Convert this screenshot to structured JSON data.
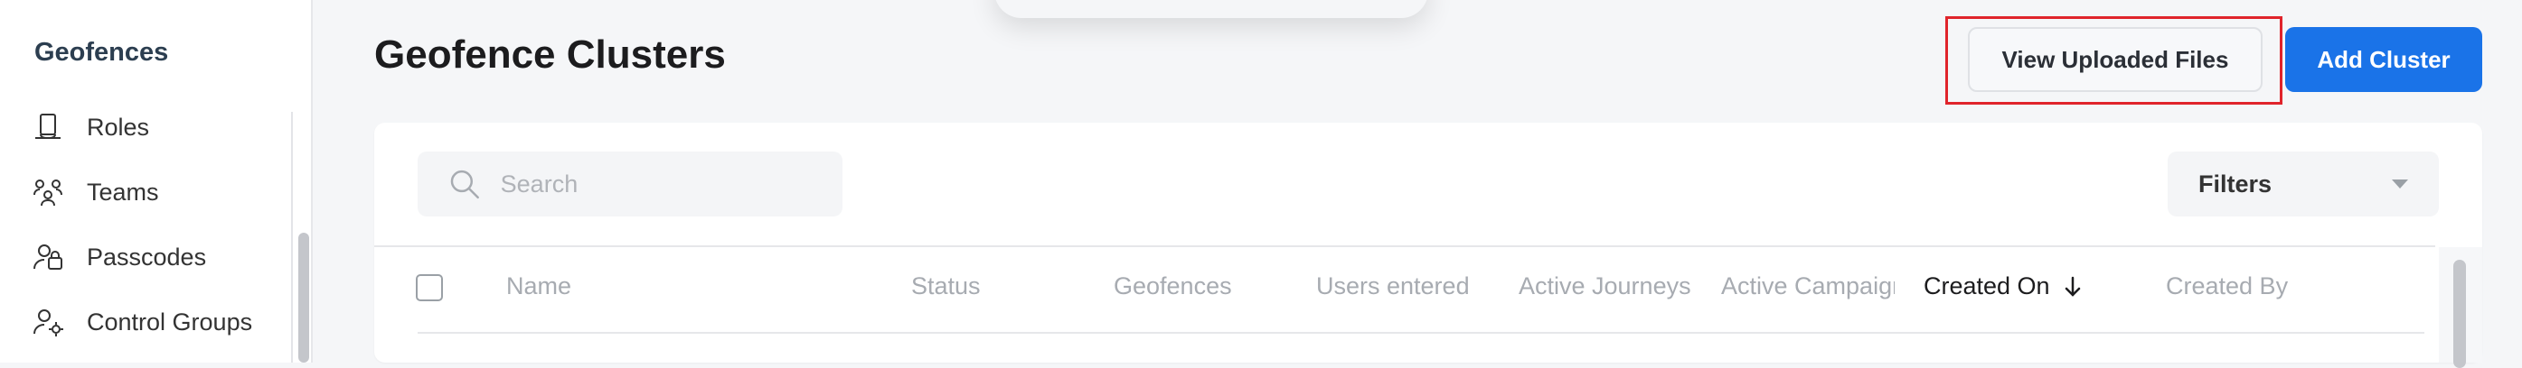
{
  "sidebar": {
    "section_title": "Geofences",
    "items": [
      {
        "label": "Roles",
        "icon": "hat-icon"
      },
      {
        "label": "Teams",
        "icon": "teams-icon"
      },
      {
        "label": "Passcodes",
        "icon": "passcodes-icon"
      },
      {
        "label": "Control Groups",
        "icon": "user-gear-icon"
      }
    ]
  },
  "header": {
    "title": "Geofence Clusters",
    "view_uploaded_label": "View Uploaded Files",
    "add_cluster_label": "Add Cluster"
  },
  "toolbar": {
    "search_placeholder": "Search",
    "filters_label": "Filters"
  },
  "table": {
    "columns": [
      "Name",
      "Status",
      "Geofences",
      "Users entered",
      "Active Journeys",
      "Active Campaigns",
      "Created On",
      "Created By"
    ],
    "sorted_column": "Created On",
    "sort_direction": "descending"
  },
  "colors": {
    "primary": "#1a73e8",
    "highlight": "#e0242b"
  }
}
